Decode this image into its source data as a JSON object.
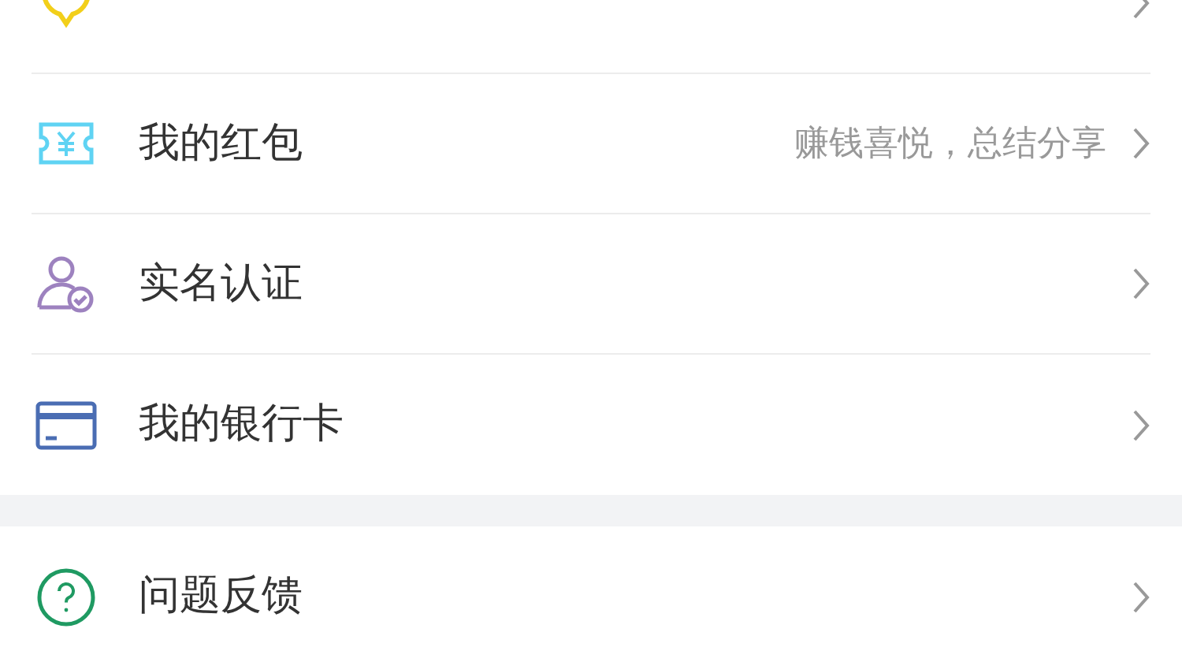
{
  "groups": [
    {
      "items": [
        {
          "kind": "promo"
        },
        {
          "kind": "ticket",
          "label": "我的红包",
          "detail": "赚钱喜悦，总结分享"
        },
        {
          "kind": "verify",
          "label": "实名认证"
        },
        {
          "kind": "card",
          "label": "我的银行卡"
        }
      ]
    },
    {
      "items": [
        {
          "kind": "help",
          "label": "问题反馈"
        }
      ]
    }
  ]
}
